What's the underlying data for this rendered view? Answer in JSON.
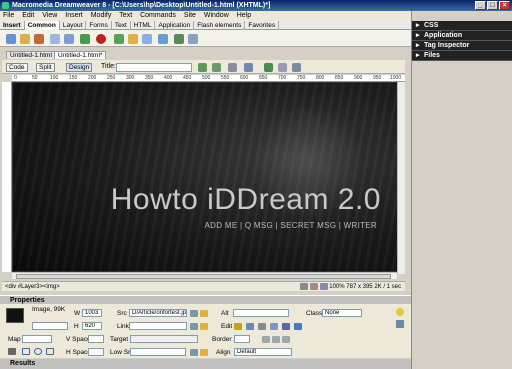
{
  "window": {
    "title": "Macromedia Dreamweaver 8 - [C:\\Users\\hp\\Desktop\\Untitled-1.html (XHTML)*]"
  },
  "menu": [
    "File",
    "Edit",
    "View",
    "Insert",
    "Modify",
    "Text",
    "Commands",
    "Site",
    "Window",
    "Help"
  ],
  "insert_bar": {
    "label": "Insert",
    "tabs": [
      "Common",
      "Layout",
      "Forms",
      "Text",
      "HTML",
      "Application",
      "Flash elements",
      "Favorites"
    ],
    "active_tab": "Common",
    "icons": [
      "hyperlink-icon",
      "email-link-icon",
      "named-anchor-icon",
      "table-icon",
      "div-icon",
      "image-icon",
      "media-icon",
      "date-icon",
      "server-include-icon",
      "comment-icon",
      "head-icon",
      "script-icon",
      "templates-icon",
      "tag-chooser-icon"
    ]
  },
  "doc_tabs": [
    "Untitled-1.html",
    "Untitled-1.html*"
  ],
  "doc_toolbar": {
    "code": "Code",
    "split": "Split",
    "design": "Design",
    "title_label": "Title:",
    "title_value": ""
  },
  "ruler_marks": [
    "0",
    "50",
    "100",
    "150",
    "200",
    "250",
    "300",
    "350",
    "400",
    "450",
    "500",
    "550",
    "600",
    "650",
    "700",
    "750",
    "800",
    "850",
    "900",
    "950",
    "1000"
  ],
  "canvas": {
    "banner_title": "Howto iDDream 2.0",
    "banner_links": "ADD ME  |  Q MSG  |  SECRET MSG  |  WRITER"
  },
  "status": {
    "tag_selector": "<div #Layer3><img>",
    "zoom": "100%",
    "dimensions": "787 x 395",
    "size_time": "2K / 1 sec"
  },
  "properties": {
    "header": "Properties",
    "image_info": "Image, 99K",
    "w_label": "W",
    "w_value": "1003",
    "h_label": "H",
    "h_value": "620",
    "src_label": "Src",
    "src_value": "D/Article/orifortest.jpg",
    "link_label": "Link",
    "link_value": "",
    "alt_label": "Alt",
    "alt_value": "",
    "edit_label": "Edit",
    "class_label": "Class",
    "class_value": "None",
    "map_label": "Map",
    "vspace_label": "V Space",
    "hspace_label": "H Space",
    "target_label": "Target",
    "lowsrc_label": "Low Src",
    "border_label": "Border",
    "align_label": "Align",
    "align_value": "Default"
  },
  "results_header": "Results",
  "panels": [
    "CSS",
    "Application",
    "Tag Inspector",
    "Files"
  ]
}
